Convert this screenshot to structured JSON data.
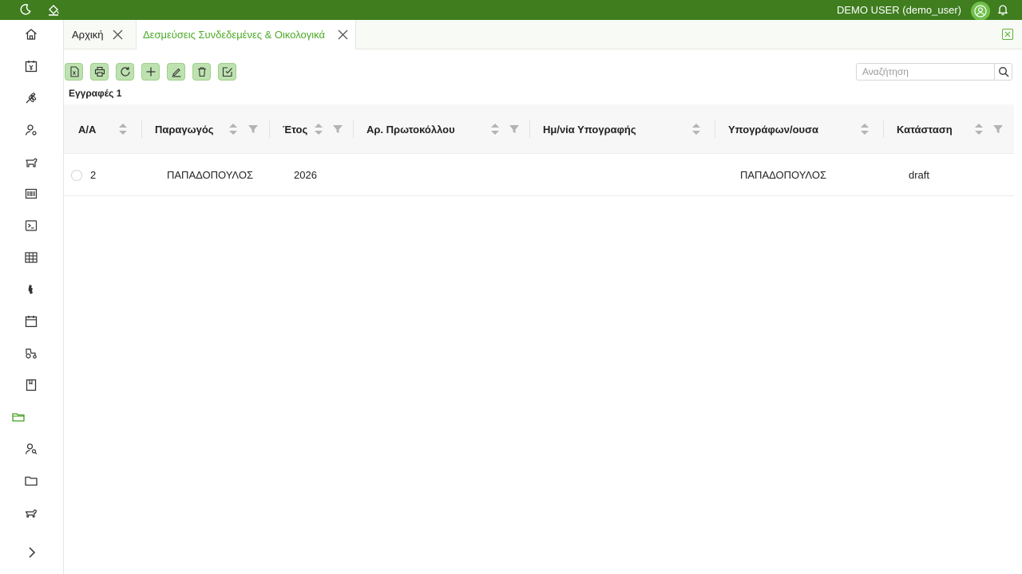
{
  "header": {
    "user_label": "DEMO USER (demo_user)",
    "icons": [
      "moon-icon",
      "paint-bucket-icon",
      "user-avatar-icon",
      "bell-icon"
    ]
  },
  "sidebar": {
    "items": [
      {
        "icon": "home-icon"
      },
      {
        "icon": "calendar-money-icon"
      },
      {
        "icon": "wheat-icon"
      },
      {
        "icon": "user-settings-icon"
      },
      {
        "icon": "cow-icon"
      },
      {
        "icon": "barcode-icon"
      },
      {
        "icon": "terminal-icon"
      },
      {
        "icon": "table-icon"
      },
      {
        "icon": "map-icon"
      },
      {
        "icon": "calendar-icon"
      },
      {
        "icon": "tractor-icon"
      },
      {
        "icon": "book-icon"
      },
      {
        "icon": "folder-open-icon",
        "active": true
      },
      {
        "icon": "user-search-icon"
      },
      {
        "icon": "folder-icon"
      },
      {
        "icon": "animal-icon"
      }
    ],
    "expand_icon": "chevron-right-icon"
  },
  "tabs": [
    {
      "label": "Αρχική",
      "active": false
    },
    {
      "label": "Δεσμεύσεις Συνδεδεμένες & Οικολογικά",
      "active": true
    }
  ],
  "toolbar": {
    "buttons": [
      "excel-export-icon",
      "print-icon",
      "refresh-icon",
      "add-icon",
      "edit-icon",
      "delete-icon",
      "approve-icon"
    ]
  },
  "search": {
    "placeholder": "Αναζήτηση",
    "value": ""
  },
  "records_label": "Εγγραφές 1",
  "table": {
    "columns": [
      {
        "label": "Α/Α",
        "sortable": true,
        "filterable": false
      },
      {
        "label": "Παραγωγός",
        "sortable": true,
        "filterable": true
      },
      {
        "label": "Έτος",
        "sortable": true,
        "filterable": true
      },
      {
        "label": "Αρ. Πρωτοκόλλου",
        "sortable": true,
        "filterable": true
      },
      {
        "label": "Ημ/νία Υπογραφής",
        "sortable": true,
        "filterable": false
      },
      {
        "label": "Υπογράφων/ουσα",
        "sortable": true,
        "filterable": false
      },
      {
        "label": "Κατάσταση",
        "sortable": true,
        "filterable": true
      }
    ],
    "rows": [
      {
        "aa": "2",
        "producer": "ΠΑΠΑΔΟΠΟΥΛΟΣ",
        "year": "2026",
        "protocol_no": "",
        "sign_date": "",
        "signer": "ΠΑΠΑΔΟΠΟΥΛΟΣ",
        "status": "draft"
      }
    ]
  },
  "colors": {
    "brand": "#3f7d1f",
    "accent": "#4aaa25",
    "button_fill": "#bde2b0"
  }
}
